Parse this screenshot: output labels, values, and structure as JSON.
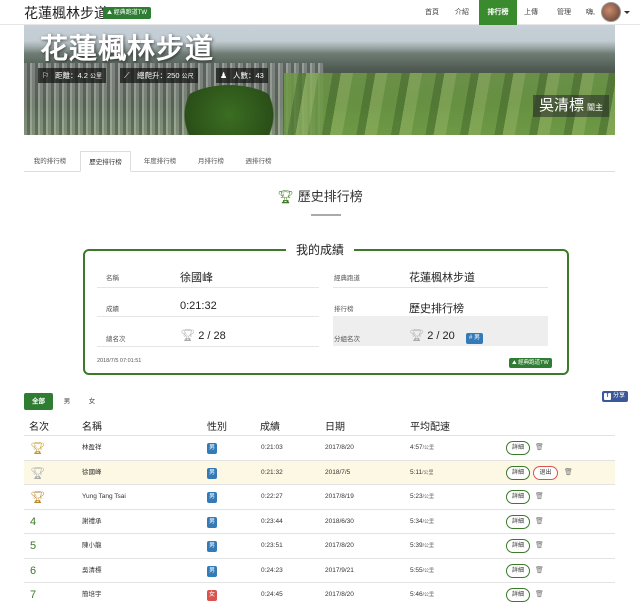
{
  "nav": {
    "brand": "花蓮楓林步道",
    "badge": "經典跑道TW",
    "items": [
      "首頁",
      "介紹",
      "排行榜",
      "上傳",
      "管理"
    ],
    "active_index": 2,
    "user_greeting": "嗨,"
  },
  "hero": {
    "title": "花蓮楓林步道",
    "distance": {
      "label": "距離：4.2",
      "unit": "公里"
    },
    "elevation": {
      "label": "總爬升：250",
      "unit": "公尺"
    },
    "people": {
      "label": "人數：43"
    },
    "owner_name": "吳清標",
    "owner_role": "關主"
  },
  "tabs": [
    "我的排行榜",
    "歷史排行榜",
    "年度排行榜",
    "月排行榜",
    "週排行榜"
  ],
  "active_tab_index": 1,
  "page_heading": "歷史排行榜",
  "my_result": {
    "title": "我的成績",
    "name_label": "名稱",
    "name_value": "徐國峰",
    "route_label": "經典跑道",
    "route_value": "花蓮楓林步道",
    "time_label": "成績",
    "time_value": "0:21:32",
    "board_label": "排行榜",
    "board_value": "歷史排行榜",
    "overall_label": "總名次",
    "overall_value": "2 / 28",
    "group_label": "分組名次",
    "group_value": "2 / 20",
    "group_badge": "男",
    "timestamp": "2018/7/5 07:01:51",
    "logo": "經典跑道TW"
  },
  "filters": [
    "全部",
    "男",
    "女"
  ],
  "share_label": "分享",
  "table": {
    "headers": [
      "名次",
      "名稱",
      "性別",
      "成績",
      "日期",
      "平均配速"
    ],
    "detail_label": "詳細",
    "quit_label": "退出",
    "pace_unit": "/公里",
    "rows": [
      {
        "rank": "gold",
        "name": "林盈祥",
        "gender": "男",
        "time": "0:21:03",
        "date": "2017/8/20",
        "pace": "4:57"
      },
      {
        "rank": "silver",
        "name": "徐國峰",
        "gender": "男",
        "time": "0:21:32",
        "date": "2018/7/5",
        "pace": "5:11",
        "highlight": true
      },
      {
        "rank": "bronze",
        "name": "Yung Tang Tsai",
        "gender": "男",
        "time": "0:22:27",
        "date": "2017/8/19",
        "pace": "5:23"
      },
      {
        "rank": "4",
        "name": "謝禮承",
        "gender": "男",
        "time": "0:23:44",
        "date": "2018/6/30",
        "pace": "5:34"
      },
      {
        "rank": "5",
        "name": "陳小龍",
        "gender": "男",
        "time": "0:23:51",
        "date": "2017/8/20",
        "pace": "5:39"
      },
      {
        "rank": "6",
        "name": "吳清標",
        "gender": "男",
        "time": "0:24:23",
        "date": "2017/9/21",
        "pace": "5:55"
      },
      {
        "rank": "7",
        "name": "簡培宇",
        "gender": "女",
        "time": "0:24:45",
        "date": "2017/8/20",
        "pace": "5:46"
      }
    ]
  },
  "colors": {
    "brand_green": "#3a8a2e",
    "gold": "#c8961e",
    "silver": "#a9a9a9",
    "bronze": "#b8862b",
    "male": "#337ab7",
    "female": "#d9534f"
  }
}
